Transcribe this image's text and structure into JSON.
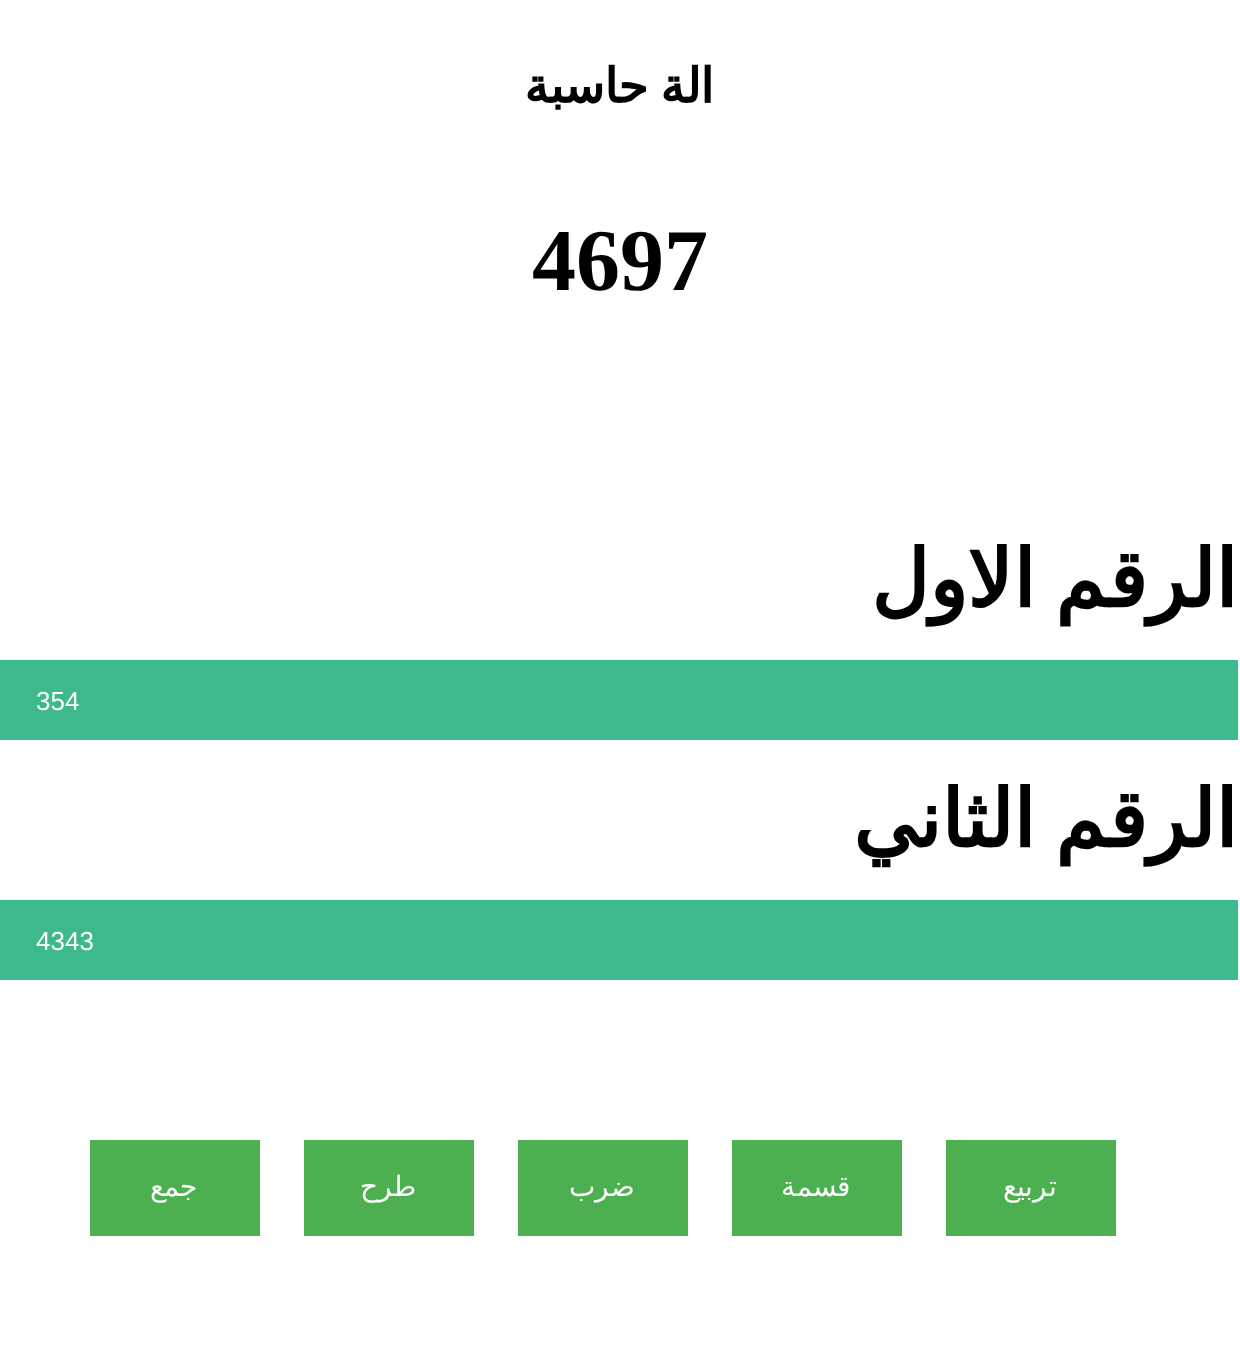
{
  "title": "الة حاسبة",
  "result": "4697",
  "fields": [
    {
      "label": "الرقم الاول",
      "value": "354"
    },
    {
      "label": "الرقم الثاني",
      "value": "4343"
    }
  ],
  "buttons": [
    "تربيع",
    "قسمة",
    "ضرب",
    "طرح",
    "جمع"
  ]
}
